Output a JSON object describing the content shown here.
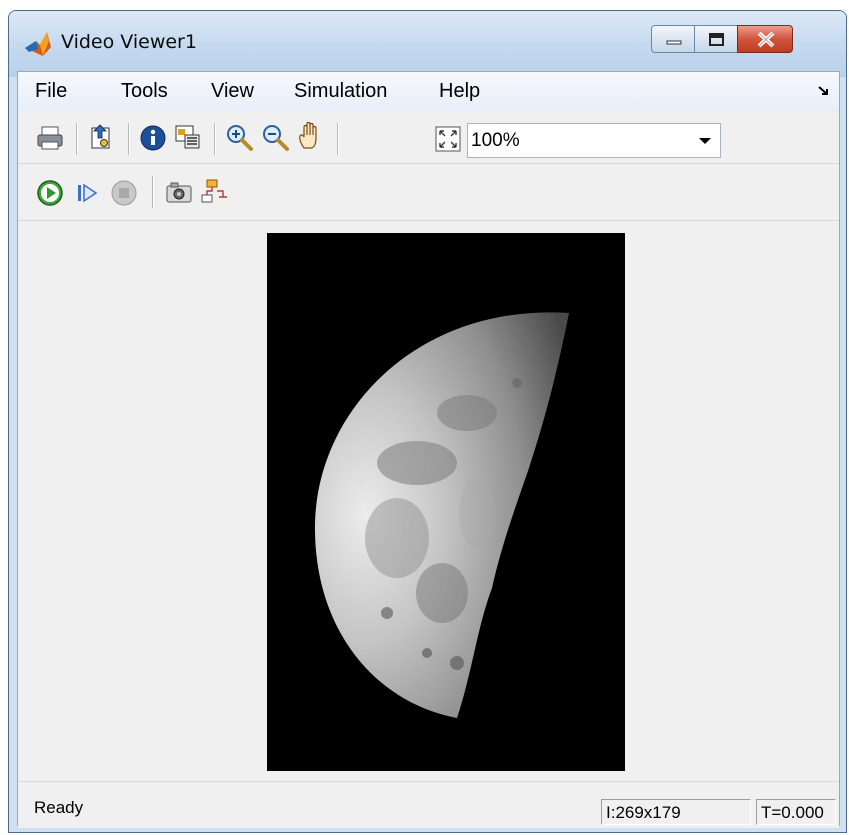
{
  "window": {
    "title": "Video Viewer1",
    "controls": [
      "minimize-icon",
      "maximize-icon",
      "close-icon"
    ]
  },
  "menubar": {
    "items": [
      "File",
      "Tools",
      "View",
      "Simulation",
      "Help"
    ]
  },
  "toolbar": {
    "icons": [
      "print-icon",
      "export-icon",
      "info-icon",
      "properties-icon",
      "zoom-in-icon",
      "zoom-out-icon",
      "pan-hand-icon",
      "fit-to-window-icon"
    ],
    "zoom": {
      "value": "100%"
    },
    "playback_icons": [
      "play-icon",
      "step-forward-icon",
      "stop-icon",
      "snapshot-camera-icon",
      "highlight-block-icon"
    ]
  },
  "viewport": {
    "image_description_icon": "moon-image"
  },
  "status": {
    "text": "Ready",
    "size": "I:269x179",
    "time": "T=0.000"
  },
  "colors": {
    "frame_bg": "#000000",
    "play_green": "#2e9a2e",
    "close_red": "#c94a2f"
  }
}
